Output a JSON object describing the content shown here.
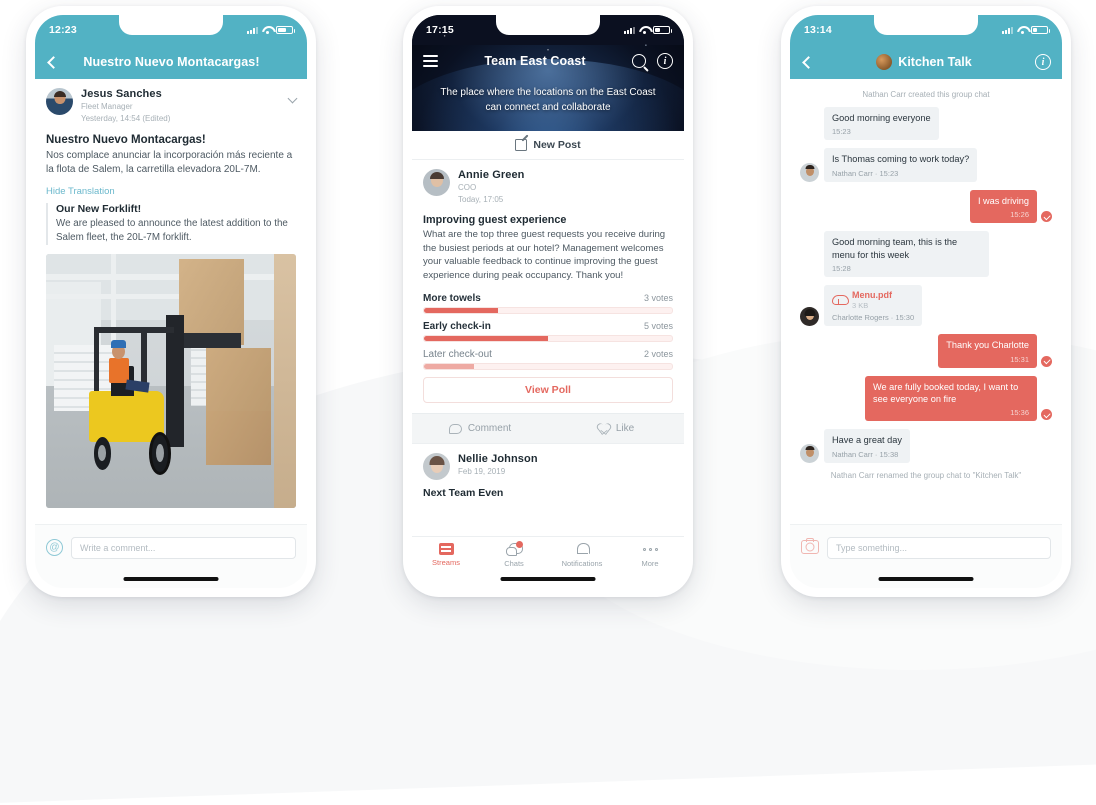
{
  "phone1": {
    "status": {
      "time": "12:23"
    },
    "nav": {
      "title": "Nuestro Nuevo Montacargas!",
      "back_icon": "chevron-left-icon"
    },
    "author": {
      "name": "Jesus  Sanches",
      "role": "Fleet Manager",
      "timestamp": "Yesterday, 14:54 (Edited)"
    },
    "post": {
      "title": "Nuestro Nuevo Montacargas!",
      "body": "Nos complace anunciar la incorporación más reciente a la flota de Salem, la carretilla elevadora 20L-7M."
    },
    "translation": {
      "toggle_label": "Hide Translation",
      "title": "Our New Forklift!",
      "body": "We are pleased to announce the latest addition to the Salem fleet, the 20L-7M forklift."
    },
    "image_alt": "forklift-in-warehouse-photo",
    "footer": {
      "mention_icon": "at-mention-icon",
      "comment_placeholder": "Write a comment..."
    }
  },
  "phone2": {
    "status": {
      "time": "17:15"
    },
    "nav": {
      "menu_icon": "hamburger-menu-icon",
      "title": "Team East Coast",
      "search_icon": "search-icon",
      "info_icon": "info-circle-icon"
    },
    "hero": {
      "subtitle": "The place where the locations on the East Coast can connect and collaborate"
    },
    "new_post": {
      "label": "New Post",
      "icon": "compose-icon"
    },
    "post": {
      "author": "Annie Green",
      "role": "COO",
      "timestamp": "Today, 17:05",
      "title": "Improving guest experience",
      "body": "What are the top three guest requests you receive during the busiest periods at our hotel? Management welcomes your valuable feedback to continue improving the guest experience during peak occupancy. Thank you!"
    },
    "poll": {
      "options": [
        {
          "label": "More towels",
          "votes": "3 votes",
          "percent": 30
        },
        {
          "label": "Early check-in",
          "votes": "5 votes",
          "percent": 50
        },
        {
          "label": "Later check-out",
          "votes": "2 votes",
          "percent": 20
        }
      ],
      "view_label": "View Poll"
    },
    "actions": {
      "comment": "Comment",
      "like": "Like"
    },
    "post2": {
      "author": "Nellie Johnson",
      "timestamp": "Feb 19, 2019",
      "title": "Next Team Even"
    },
    "tabs": [
      {
        "label": "Streams",
        "icon": "streams-icon",
        "active": true
      },
      {
        "label": "Chats",
        "icon": "chats-icon",
        "active": false
      },
      {
        "label": "Notifications",
        "icon": "bell-icon",
        "active": false
      },
      {
        "label": "More",
        "icon": "more-dots-icon",
        "active": false
      }
    ]
  },
  "phone3": {
    "status": {
      "time": "13:14"
    },
    "nav": {
      "title": "Kitchen Talk",
      "back_icon": "chevron-left-icon",
      "info_icon": "info-circle-icon",
      "avatar": "group-avatar"
    },
    "system_top": "Nathan Carr created this group chat",
    "system_bottom": "Nathan Carr renamed the group chat to \"Kitchen Talk\"",
    "messages": [
      {
        "dir": "in",
        "avatar": false,
        "text": "Good morning everyone",
        "meta": "15:23"
      },
      {
        "dir": "in",
        "avatar": "nathan",
        "text": "Is Thomas coming to work today?",
        "meta": "Nathan Carr · 15:23"
      },
      {
        "dir": "out",
        "avatar": false,
        "text": "I was driving",
        "meta": "15:26"
      },
      {
        "dir": "in",
        "avatar": false,
        "text": "Good morning team, this is the menu for this week",
        "meta": "15:28"
      },
      {
        "dir": "in",
        "avatar": "charlotte",
        "file": {
          "name": "Menu.pdf",
          "size": "3 KB",
          "icon": "cloud-download-icon"
        },
        "meta": "Charlotte Rogers · 15:30"
      },
      {
        "dir": "out",
        "avatar": false,
        "text": "Thank you Charlotte",
        "meta": "15:31"
      },
      {
        "dir": "out",
        "avatar": false,
        "text": "We are fully booked today, I want to see everyone on fire",
        "meta": "15:36"
      },
      {
        "dir": "in",
        "avatar": "nathan",
        "text": "Have a great day",
        "meta": "Nathan Carr · 15:38"
      }
    ],
    "footer": {
      "camera_icon": "camera-icon",
      "input_placeholder": "Type something..."
    }
  },
  "colors": {
    "teal": "#52b2c4",
    "coral": "#e4685f",
    "dark_navy": "#0b1020"
  }
}
